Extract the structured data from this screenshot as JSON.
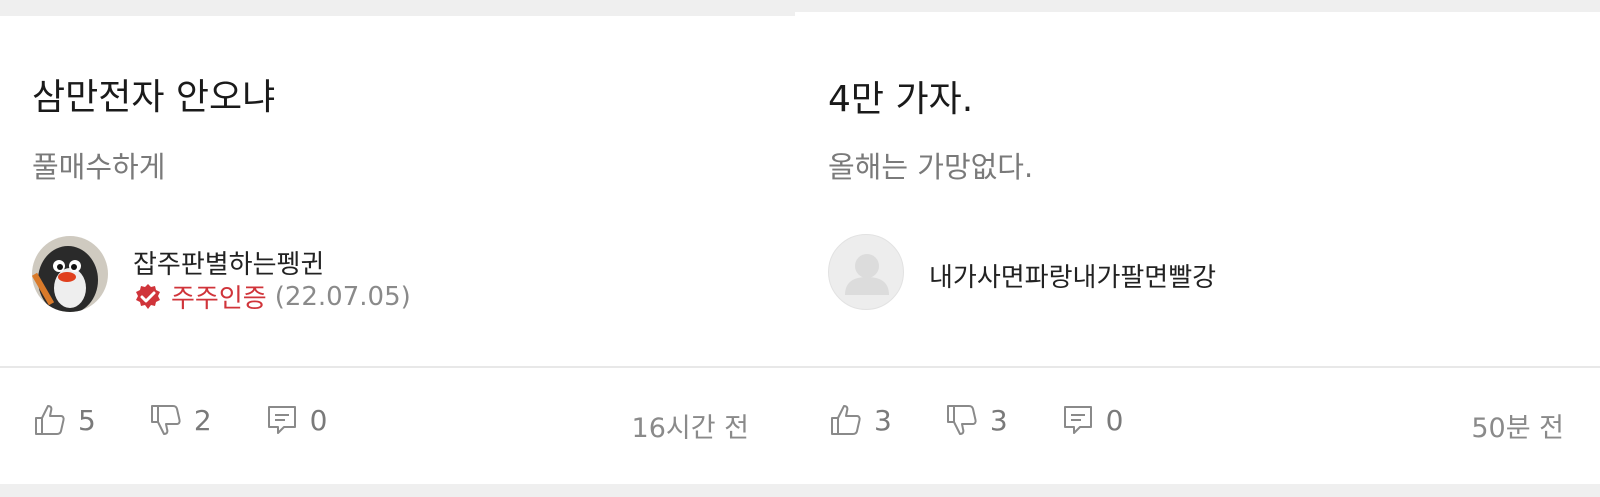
{
  "posts": [
    {
      "title": "삼만전자 안오냐",
      "body": "풀매수하게",
      "author": {
        "name": "잡주판별하는펭귄",
        "avatar": "penguin-avatar",
        "badge": "주주인증",
        "badge_date": "(22.07.05)",
        "badge_color": "#d0343a"
      },
      "likes": "5",
      "dislikes": "2",
      "comments": "0",
      "time": "16시간 전"
    },
    {
      "title": "4만 가자.",
      "body": "올해는 가망없다.",
      "author": {
        "name": "내가사면파랑내가팔면빨강",
        "avatar": "default-user-avatar"
      },
      "likes": "3",
      "dislikes": "3",
      "comments": "0",
      "time": "50분 전"
    }
  ]
}
